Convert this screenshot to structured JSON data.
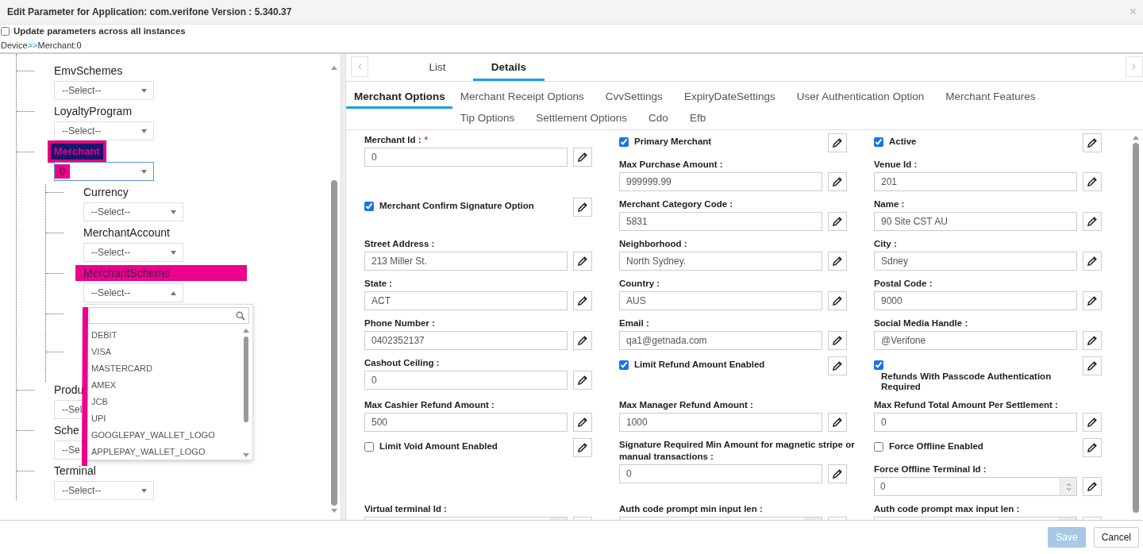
{
  "dialog": {
    "title": "Edit Parameter for Application: com.verifone Version : 5.340.37",
    "close": "×"
  },
  "update_all": {
    "label": "Update parameters across all instances",
    "checked": false
  },
  "breadcrumb": {
    "root": "Device",
    "separator": ">>",
    "current": "Merchant:0"
  },
  "tree": [
    {
      "label": "EmvSchemes",
      "value": "--Select--"
    },
    {
      "label": "LoyaltyProgram",
      "value": "--Select--"
    },
    {
      "label": "Merchant",
      "value": "0",
      "highlighted": true,
      "bold": true,
      "value_highlighted": true,
      "focused": true,
      "children": [
        {
          "label": "Currency",
          "value": "--Select--"
        },
        {
          "label": "MerchantAccount",
          "value": "--Select--"
        },
        {
          "label": "MerchantScheme",
          "value": "--Select--",
          "highlighted": true,
          "bold": false,
          "open": true
        }
      ]
    },
    {
      "label": "Produ",
      "value": "--Sel"
    },
    {
      "label": "Sche",
      "value": "--Se"
    },
    {
      "label": "Terminal",
      "value": "--Select--"
    }
  ],
  "scheme_dropdown": {
    "marked": true,
    "options": [
      "DEBIT",
      "VISA",
      "MASTERCARD",
      "AMEX",
      "JCB",
      "UPI",
      "GOOGLEPAY_WALLET_LOGO",
      "APPLEPAY_WALLET_LOGO"
    ]
  },
  "tabs": [
    {
      "label": "List",
      "selected": false
    },
    {
      "label": "Details",
      "selected": true
    }
  ],
  "subtabs": [
    {
      "label": "Merchant Options",
      "selected": true
    },
    {
      "label": "Merchant Receipt Options",
      "selected": false
    },
    {
      "label": "CvvSettings",
      "selected": false
    },
    {
      "label": "ExpiryDateSettings",
      "selected": false
    },
    {
      "label": "User Authentication Option",
      "selected": false
    },
    {
      "label": "Merchant Features",
      "selected": false
    },
    {
      "label": "Tip Options",
      "selected": false
    },
    {
      "label": "Settlement Options",
      "selected": false
    },
    {
      "label": "Cdo",
      "selected": false
    },
    {
      "label": "Efb",
      "selected": false
    }
  ],
  "form_rows": [
    {
      "cells": [
        {
          "items": [
            {
              "kind": "text",
              "label": "Merchant Id :",
              "required_mark": "*",
              "value": "0"
            }
          ]
        },
        {
          "items": [
            {
              "kind": "check",
              "label": "Primary Merchant",
              "checked": true
            },
            {
              "kind": "text",
              "label": "Max Purchase Amount :",
              "value": "999999.99"
            }
          ]
        },
        {
          "items": [
            {
              "kind": "check",
              "label": "Active",
              "checked": true
            },
            {
              "kind": "text",
              "label": "Venue Id :",
              "value": "201"
            }
          ]
        }
      ]
    },
    {
      "cells": [
        {
          "items": [
            {
              "kind": "check",
              "label": "Merchant Confirm Signature Option",
              "checked": true
            }
          ]
        },
        {
          "items": [
            {
              "kind": "text",
              "label": "Merchant Category Code :",
              "value": "5831"
            }
          ]
        },
        {
          "items": [
            {
              "kind": "text",
              "label": "Name :",
              "value": "90 Site CST AU"
            }
          ]
        }
      ]
    },
    {
      "cells": [
        {
          "items": [
            {
              "kind": "text",
              "label": "Street Address :",
              "value": "213 Miller St."
            }
          ]
        },
        {
          "items": [
            {
              "kind": "text",
              "label": "Neighborhood :",
              "value": "North Sydney."
            }
          ]
        },
        {
          "items": [
            {
              "kind": "text",
              "label": "City :",
              "value": "Sdney"
            }
          ]
        }
      ]
    },
    {
      "cells": [
        {
          "items": [
            {
              "kind": "text",
              "label": "State :",
              "value": "ACT"
            }
          ]
        },
        {
          "items": [
            {
              "kind": "text",
              "label": "Country :",
              "value": "AUS"
            }
          ]
        },
        {
          "items": [
            {
              "kind": "text",
              "label": "Postal Code :",
              "value": "9000"
            }
          ]
        }
      ]
    },
    {
      "cells": [
        {
          "items": [
            {
              "kind": "text",
              "label": "Phone Number :",
              "value": "0402352137"
            }
          ]
        },
        {
          "items": [
            {
              "kind": "text",
              "label": "Email :",
              "value": "qa1@getnada.com"
            }
          ]
        },
        {
          "items": [
            {
              "kind": "text",
              "label": "Social Media Handle :",
              "value": "@Verifone"
            }
          ]
        }
      ]
    },
    {
      "cells": [
        {
          "items": [
            {
              "kind": "text",
              "label": "Cashout Ceiling :",
              "value": "0"
            }
          ]
        },
        {
          "items": [
            {
              "kind": "check",
              "label": "Limit Refund Amount Enabled",
              "checked": true
            }
          ]
        },
        {
          "items": [
            {
              "kind": "check",
              "label": "Refunds With Passcode Authentication Required",
              "checked": true,
              "label_below": true
            }
          ]
        }
      ]
    },
    {
      "cells": [
        {
          "items": [
            {
              "kind": "text",
              "label": "Max Cashier Refund Amount :",
              "value": "500"
            }
          ]
        },
        {
          "items": [
            {
              "kind": "text",
              "label": "Max Manager Refund Amount :",
              "value": "1000"
            }
          ]
        },
        {
          "items": [
            {
              "kind": "text",
              "label": "Max Refund Total Amount Per Settlement :",
              "value": "0"
            }
          ]
        }
      ]
    },
    {
      "cells": [
        {
          "items": [
            {
              "kind": "check",
              "label": "Limit Void Amount Enabled",
              "checked": false
            }
          ]
        },
        {
          "items": [
            {
              "kind": "text",
              "label": "Signature Required Min Amount for magnetic stripe or manual transactions :",
              "value": "0"
            }
          ]
        },
        {
          "items": [
            {
              "kind": "check",
              "label": "Force Offline Enabled",
              "checked": false
            },
            {
              "kind": "number",
              "label": "Force Offline Terminal Id :",
              "value": "0"
            }
          ]
        }
      ]
    },
    {
      "cells": [
        {
          "items": [
            {
              "kind": "number",
              "label": "Virtual terminal Id :"
            }
          ]
        },
        {
          "items": [
            {
              "kind": "number",
              "label": "Auth code prompt min input len :"
            }
          ]
        },
        {
          "items": [
            {
              "kind": "number",
              "label": "Auth code prompt max input len :"
            }
          ]
        }
      ]
    }
  ],
  "footer": {
    "buttons": [
      {
        "label": "Save",
        "disabled": true
      },
      {
        "label": "Cancel",
        "disabled": false
      }
    ]
  }
}
